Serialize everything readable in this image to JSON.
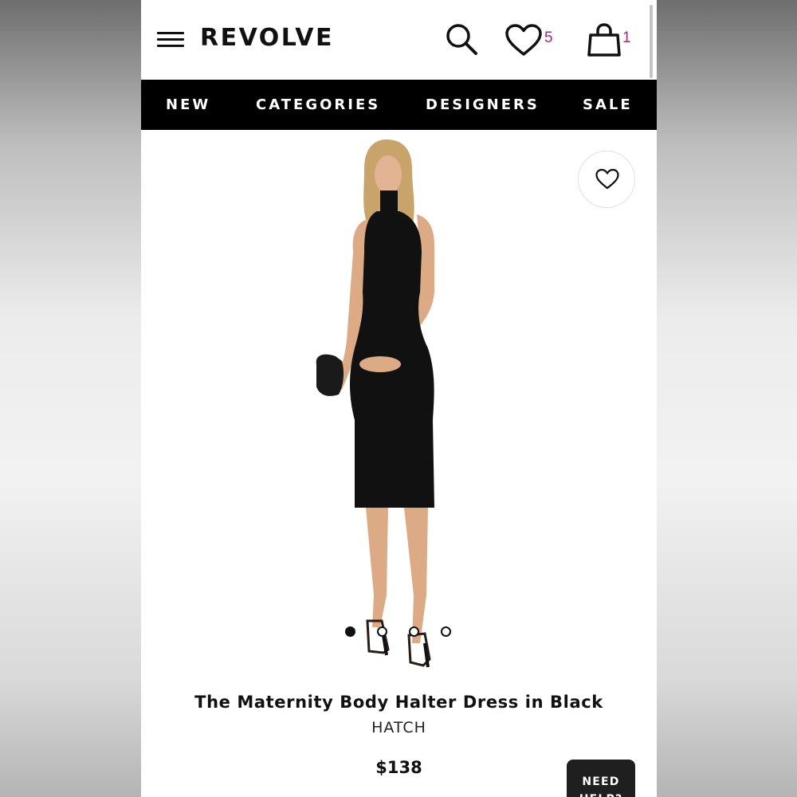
{
  "header": {
    "logo": "REVOLVE",
    "wishlist_count": "5",
    "bag_count": "1",
    "accent_color": "#a4267f",
    "icons": [
      "menu-icon",
      "search-icon",
      "heart-icon",
      "shopping-bag-icon"
    ]
  },
  "nav": {
    "items": [
      {
        "label": "NEW"
      },
      {
        "label": "CATEGORIES"
      },
      {
        "label": "DESIGNERS"
      },
      {
        "label": "SALE"
      }
    ]
  },
  "product": {
    "title": "The Maternity Body Halter Dress in Black",
    "brand": "HATCH",
    "price": "$138",
    "image_count": 4,
    "active_image_index": 0
  },
  "help_button": {
    "label": "NEED HELP?"
  }
}
